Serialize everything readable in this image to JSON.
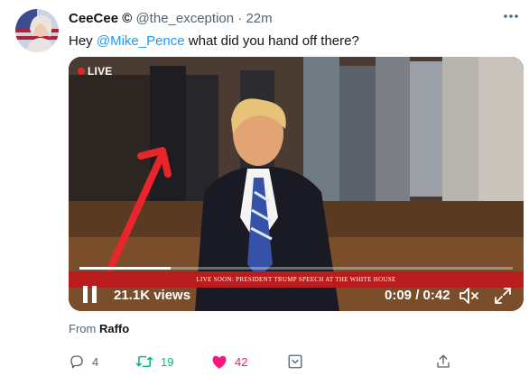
{
  "tweet": {
    "author_name": "CeeCee",
    "author_symbol": "©",
    "handle": "@the_exception",
    "separator": "·",
    "timestamp": "22m",
    "text_prefix": "Hey ",
    "mention": "@Mike_Pence",
    "text_suffix": " what did you hand off there?",
    "source_prefix": "From ",
    "source_name": "Raffo"
  },
  "video": {
    "live_label": "LIVE",
    "lower_third": "LIVE SOON: PRESIDENT TRUMP SPEECH AT THE WHITE HOUSE",
    "views": "21.1K views",
    "timecode": "0:09 / 0:42",
    "progress_fraction": 0.21
  },
  "actions": {
    "reply_count": "4",
    "retweet_count": "19",
    "like_count": "42"
  },
  "colors": {
    "accent": "#1d9bf0",
    "retweet": "#00ba7c",
    "like": "#f91880",
    "secondary_text": "#536471"
  },
  "icons": [
    "more-icon",
    "pause-icon",
    "mute-icon",
    "fullscreen-icon",
    "reply-icon",
    "retweet-icon",
    "like-icon",
    "bookmark-icon",
    "share-icon"
  ]
}
